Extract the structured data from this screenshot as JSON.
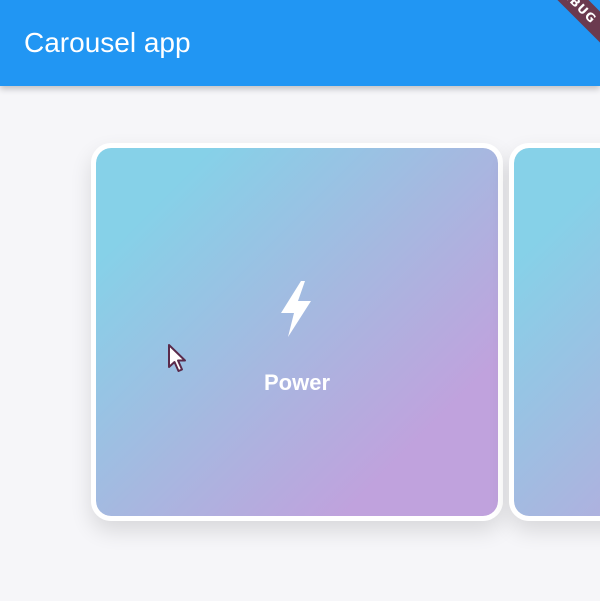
{
  "appbar": {
    "title": "Carousel app",
    "color": "#2196f3"
  },
  "debug_banner": {
    "label": "DEBUG"
  },
  "carousel": {
    "cards": [
      {
        "label": "Power",
        "icon": "lightning-bolt-icon",
        "gradient_start": "#86d1e8",
        "gradient_end": "#c0a2dd"
      },
      {
        "label": "",
        "icon": "",
        "gradient_start": "#86d1e8",
        "gradient_end": "#c0a2dd"
      }
    ]
  },
  "colors": {
    "background": "#f6f6f9",
    "card_border": "#ffffff"
  }
}
